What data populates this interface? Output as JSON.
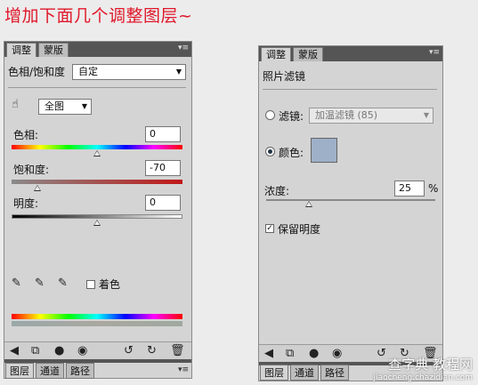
{
  "headline": "增加下面几个调整图层~",
  "left_panel": {
    "tabs": [
      "调整",
      "蒙版"
    ],
    "menu_icon": "▾≡",
    "adjust_title": "色相/饱和度",
    "preset_value": "自定",
    "channel_value": "全图",
    "hue": {
      "label": "色相:",
      "value": "0",
      "level": 0.5
    },
    "saturation": {
      "label": "饱和度:",
      "value": "-70",
      "level": 0.15
    },
    "lightness": {
      "label": "明度:",
      "value": "0",
      "level": 0.5
    },
    "colorize_label": "着色",
    "bottom_tabs": [
      "图层",
      "通道",
      "路径"
    ]
  },
  "right_panel": {
    "tabs": [
      "调整",
      "蒙版"
    ],
    "menu_icon": "▾≡",
    "title": "照片滤镜",
    "filter_label": "滤镜:",
    "filter_value": "加温滤镜 (85)",
    "color_label": "颜色:",
    "swatch_color": "#9db0c8",
    "density_label": "浓度:",
    "density_value": "25",
    "density_unit": "%",
    "density_level": 0.25,
    "preserve_label": "保留明度",
    "bottom_tabs": [
      "图层",
      "通道",
      "路径"
    ]
  },
  "watermark": {
    "text": "查字典 教程网",
    "url": "jiaocheng.chazidian.com"
  }
}
